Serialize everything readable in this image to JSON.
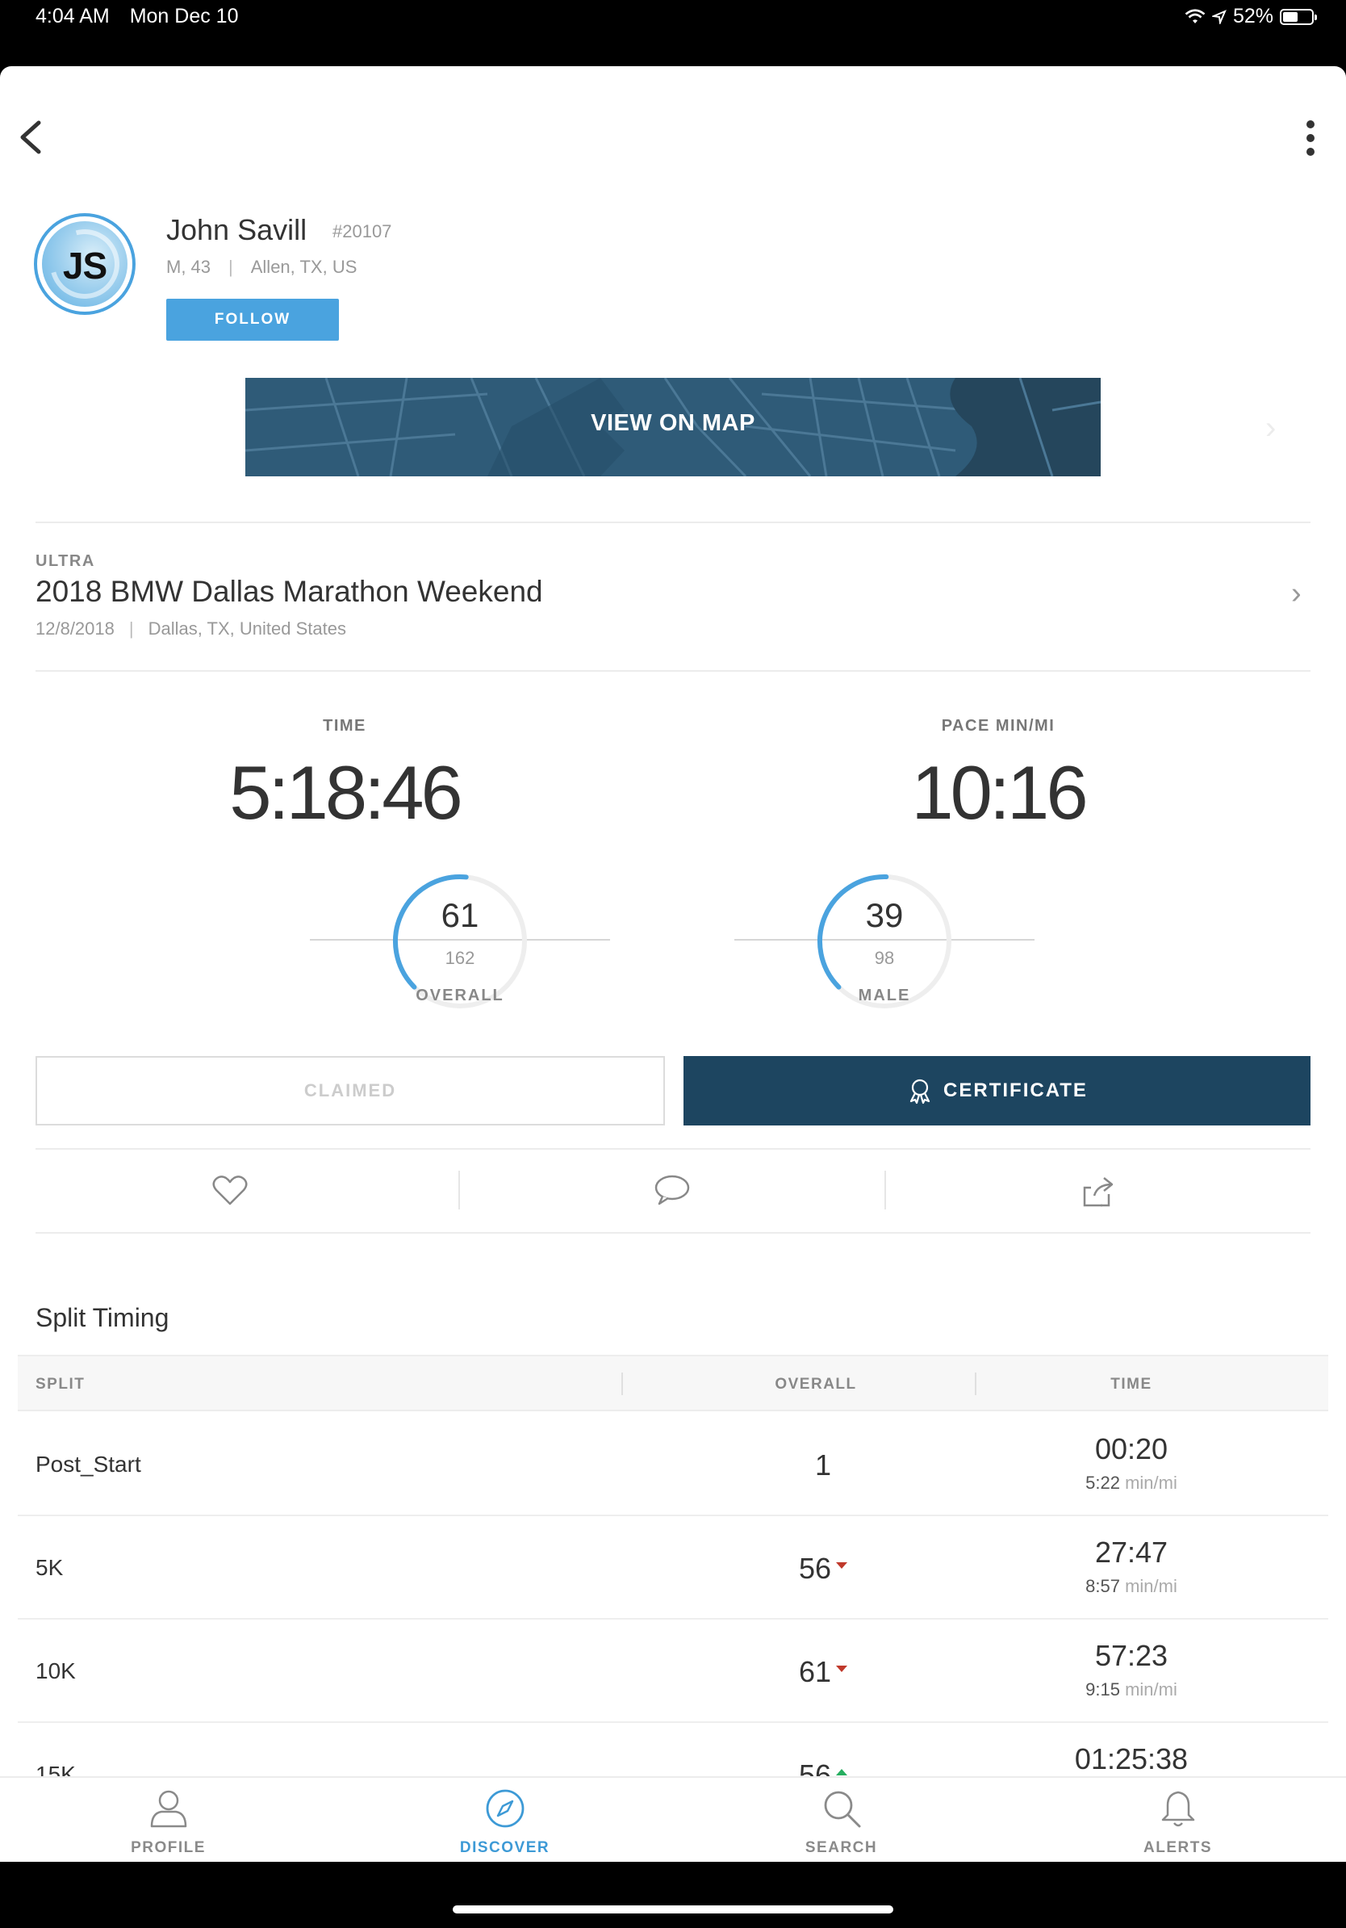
{
  "status_bar": {
    "time": "4:04 AM",
    "date": "Mon Dec 10",
    "battery": "52%",
    "battery_level": 0.52
  },
  "profile": {
    "initials": "JS",
    "name": "John Savill",
    "bib": "#20107",
    "gender_age": "M, 43",
    "location": "Allen, TX, US",
    "follow_label": "FOLLOW"
  },
  "map": {
    "label": "VIEW ON MAP"
  },
  "race": {
    "category": "ULTRA",
    "name": "2018 BMW Dallas Marathon Weekend",
    "date": "12/8/2018",
    "location": "Dallas, TX, United States"
  },
  "result": {
    "time_label": "TIME",
    "time": "5:18:46",
    "pace_label": "PACE MIN/MI",
    "pace": "10:16",
    "overall": {
      "rank": "61",
      "total": "162",
      "label": "OVERALL"
    },
    "gender": {
      "rank": "39",
      "total": "98",
      "label": "MALE"
    }
  },
  "buttons": {
    "claimed": "CLAIMED",
    "certificate": "CERTIFICATE"
  },
  "split_timing": {
    "title": "Split Timing",
    "headers": {
      "split": "SPLIT",
      "overall": "OVERALL",
      "time": "TIME"
    },
    "rows": [
      {
        "split": "Post_Start",
        "overall": "1",
        "trend": "",
        "time": "00:20",
        "pace": "5:22",
        "pace_unit": "min/mi"
      },
      {
        "split": "5K",
        "overall": "56",
        "trend": "down",
        "time": "27:47",
        "pace": "8:57",
        "pace_unit": "min/mi"
      },
      {
        "split": "10K",
        "overall": "61",
        "trend": "down",
        "time": "57:23",
        "pace": "9:15",
        "pace_unit": "min/mi"
      },
      {
        "split": "15K",
        "overall": "56",
        "trend": "up",
        "time": "01:25:38",
        "pace": "",
        "pace_unit": ""
      }
    ]
  },
  "tabbar": {
    "items": [
      {
        "label": "PROFILE",
        "icon": "person-icon"
      },
      {
        "label": "DISCOVER",
        "icon": "compass-icon"
      },
      {
        "label": "SEARCH",
        "icon": "search-icon"
      },
      {
        "label": "ALERTS",
        "icon": "bell-icon"
      }
    ],
    "active_color": "#3d9ad6"
  },
  "colors": {
    "accent": "#4aa3df",
    "certificate_bg": "#1d4560",
    "map_bg": "#2f5b78"
  }
}
